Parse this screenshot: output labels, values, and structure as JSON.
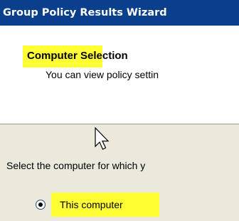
{
  "window": {
    "title": "Group Policy Results Wizard"
  },
  "header": {
    "title": "Computer Selection",
    "subtitle": "You can view policy settin"
  },
  "body": {
    "instruction": "Select the computer for which y",
    "radio_this_computer": {
      "label": "This computer",
      "selected": true
    }
  },
  "colors": {
    "title_bar": "#0a3f8c",
    "highlight": "#ffff33",
    "dialog_background": "#ebe9dc"
  },
  "icons": {
    "cursor": "mouse-pointer-icon"
  }
}
